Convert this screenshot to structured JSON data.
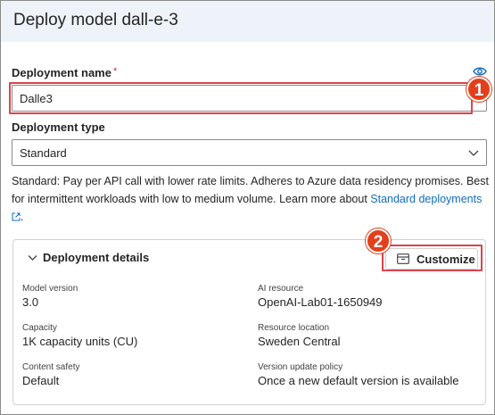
{
  "header": {
    "title": "Deploy model dall-e-3"
  },
  "deployment_name": {
    "label": "Deployment name",
    "required_marker": "*",
    "value": "Dalle3"
  },
  "deployment_type": {
    "label": "Deployment type",
    "selected": "Standard",
    "description": "Standard: Pay per API call with lower rate limits. Adheres to Azure data residency promises. Best for intermittent workloads with low to medium volume. Learn more about ",
    "link_text": "Standard deployments"
  },
  "annotations": {
    "badge_1": "1",
    "badge_2": "2",
    "color": "#e2401c"
  },
  "details": {
    "heading": "Deployment details",
    "customize_label": "Customize",
    "properties": [
      {
        "key": "Model version",
        "value": "3.0"
      },
      {
        "key": "AI resource",
        "value": "OpenAI-Lab01-1650949"
      },
      {
        "key": "Capacity",
        "value": "1K capacity units (CU)"
      },
      {
        "key": "Resource location",
        "value": "Sweden Central"
      },
      {
        "key": "Content safety",
        "value": "Default"
      },
      {
        "key": "Version update policy",
        "value": "Once a new default version is available"
      }
    ]
  },
  "icons": [
    "eye-icon",
    "chevron-down-icon",
    "external-link-icon",
    "customize-icon"
  ],
  "colors": {
    "accent": "#0f6cbd",
    "header_bg": "#eef3f9",
    "highlight": "#d64550"
  }
}
